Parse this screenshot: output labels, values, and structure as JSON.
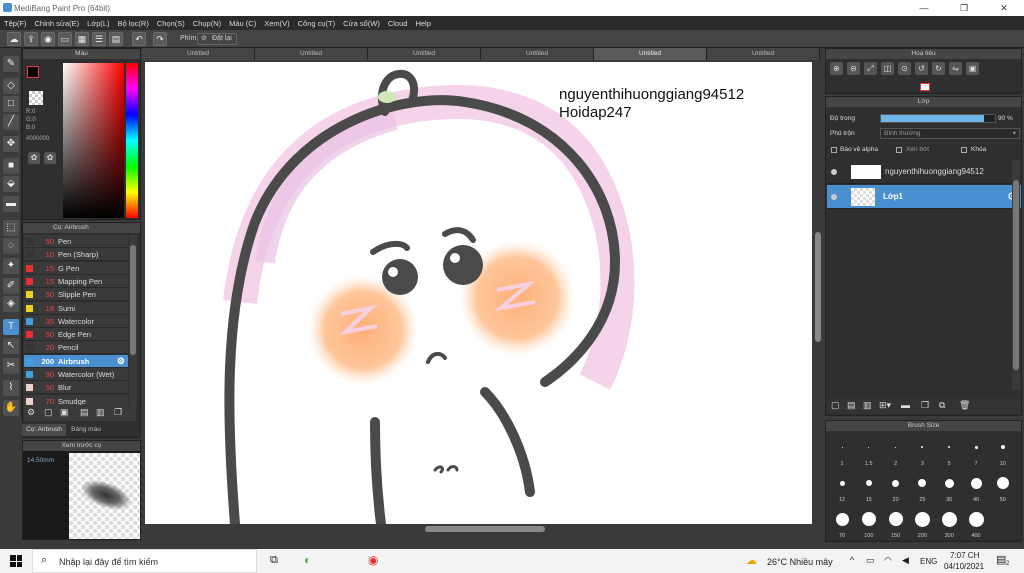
{
  "window": {
    "title": "MediBang Paint Pro (64bit)"
  },
  "menu": [
    "Tệp(F)",
    "Chỉnh sửa(E)",
    "Lớp(L)",
    "Bộ lọc(R)",
    "Chọn(S)",
    "Chụp(N)",
    "Màu (C)",
    "Xem(V)",
    "Công cụ(T)",
    "Cửa sổ(W)",
    "Cloud",
    "Help"
  ],
  "toolbar": {
    "phim_label": "Phím",
    "reset_label": "Đặt lại"
  },
  "doc_tabs": [
    "Untitled",
    "Untitled",
    "Untitled",
    "Untitled",
    "Untitled",
    "Untitled"
  ],
  "color_panel": {
    "title": "Màu",
    "r": "R:0",
    "g": "G:0",
    "b": "B:0",
    "hex": "#000000"
  },
  "brush_panel": {
    "title": "Cọ: Airbrush",
    "items": [
      {
        "size": "50",
        "name": "Pen",
        "color": "#333333"
      },
      {
        "size": "10",
        "name": "Pen (Sharp)",
        "color": "#333333"
      },
      {
        "size": "15",
        "name": "G Pen",
        "color": "#e83030"
      },
      {
        "size": "15",
        "name": "Mapping Pen",
        "color": "#e83030"
      },
      {
        "size": "50",
        "name": "Slipple Pen",
        "color": "#f0d020"
      },
      {
        "size": "19",
        "name": "Sumi",
        "color": "#f0d020"
      },
      {
        "size": "35",
        "name": "Watercolor",
        "color": "#40a0e0"
      },
      {
        "size": "50",
        "name": "Edge Pen",
        "color": "#e83030"
      },
      {
        "size": "20",
        "name": "Pencil",
        "color": "#333333"
      },
      {
        "size": "200",
        "name": "Airbrush",
        "color": "#40a0e0"
      },
      {
        "size": "90",
        "name": "Watercolor (Wet)",
        "color": "#40a0e0"
      },
      {
        "size": "50",
        "name": "Blur",
        "color": "#f0d0d0"
      },
      {
        "size": "70",
        "name": "Smudge",
        "color": "#f0d0d0"
      }
    ],
    "tab1": "Cọ: Airbrush",
    "tab2": "Bảng màu"
  },
  "preview_panel": {
    "title": "Xem trước cọ",
    "size": "14.50mm"
  },
  "navigator": {
    "title": "Hoa tiêu"
  },
  "layer_panel": {
    "title": "Lớp",
    "opacity_label": "Độ trong",
    "opacity_value": "90 %",
    "opacity_fraction": 0.9,
    "blend_label": "Phủ trộn",
    "blend_value": "Bình thường",
    "protect_alpha": "Bảo vệ alpha",
    "clipping": "Xén bớt",
    "lock": "Khóa",
    "layers": [
      {
        "name": "nguyenthihuonggiang94512",
        "selected": false
      },
      {
        "name": "Lớp1",
        "selected": true
      }
    ]
  },
  "brush_size": {
    "title": "Brush Size",
    "sizes": [
      "1",
      "1.5",
      "2",
      "3",
      "5",
      "7",
      "10",
      "12",
      "15",
      "20",
      "25",
      "30",
      "40",
      "50",
      "70",
      "100",
      "150",
      "200",
      "300",
      "400"
    ]
  },
  "canvas_text": {
    "line1": "nguyenthihuonggiang94512",
    "line2": "Hoidap247"
  },
  "taskbar": {
    "search": "Nhập lại đây để tìm kiếm",
    "weather": "26°C  Nhiều mây",
    "lang": "ENG",
    "time": "7:07 CH",
    "date": "04/10/2021",
    "notif": "2"
  }
}
